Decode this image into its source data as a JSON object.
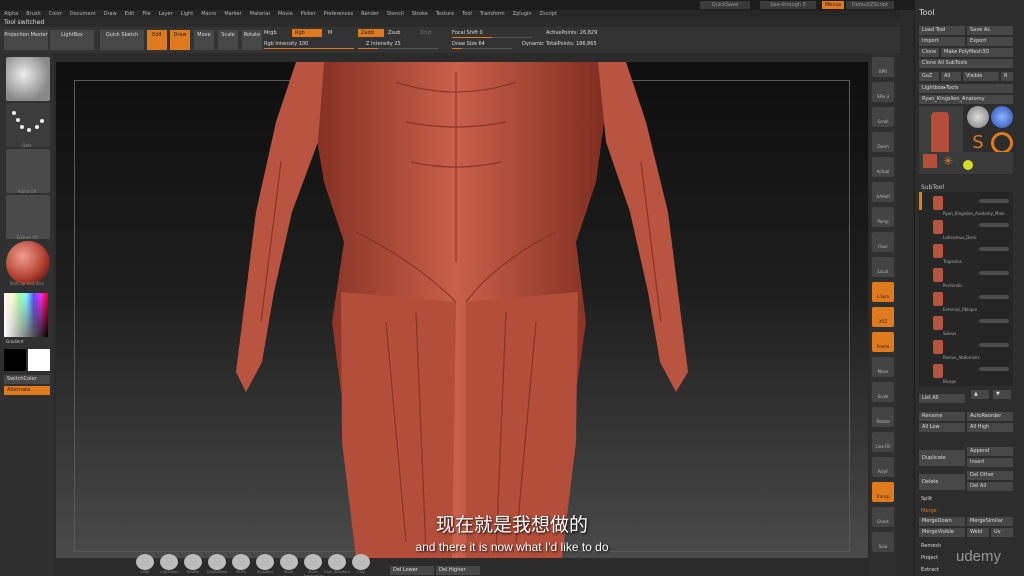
{
  "titlebar": {
    "quicksave": "QuickSave",
    "menus": "See-through 0",
    "default": "Menus",
    "script": "DefaultZScript"
  },
  "menu": [
    "Alpha",
    "Brush",
    "Color",
    "Document",
    "Draw",
    "Edit",
    "File",
    "Layer",
    "Light",
    "Macro",
    "Marker",
    "Material",
    "Movie",
    "Picker",
    "Preferences",
    "Render",
    "Stencil",
    "Stroke",
    "Texture",
    "Tool",
    "Transform",
    "Zplugin",
    "Zscript"
  ],
  "tool_status": "Tool switched",
  "shelf": {
    "projection_master": "Projection Master",
    "lightbox": "LightBox",
    "quick_sketch": "Quick Sketch",
    "edit": "Edit",
    "draw": "Draw",
    "move": "Move",
    "scale": "Scale",
    "rotate": "Rotate",
    "mrgb": "Mrgb",
    "rgb": "Rgb",
    "m": "M",
    "rgb_intensity": "Rgb Intensity 100",
    "zadd": "Zadd",
    "zsub": "Zsub",
    "zcut": "Zcut",
    "z_intensity": "Z Intensity 25",
    "focal_shift": "Focal Shift 0",
    "draw_size": "Draw Size 64",
    "dynamic": "Dynamic",
    "active_points": "ActivePoints: 26,829",
    "total_points": "TotalPoints: 186,865"
  },
  "left": {
    "brush": "Standard",
    "stroke": "Dots",
    "alpha": "Alpha Off",
    "texture": "Texture Off",
    "material": "MatCap Red Wax",
    "gradient": "Gradient",
    "switch_color": "SwitchColor",
    "alternate": "Alternate"
  },
  "rightshelf": [
    "BPR",
    "SPix 3",
    "Scroll",
    "Zoom",
    "Actual",
    "AAHalf",
    "Persp",
    "Floor",
    "Local",
    "L.Sym",
    "XYZ",
    "Frame",
    "Move",
    "Scale",
    "Rotate",
    "Line Fill",
    "PolyF",
    "Transp",
    "Ghost",
    "Solo"
  ],
  "toolpanel": {
    "header": "Tool",
    "load_tool": "Load Tool",
    "save_as": "Save As",
    "import": "Import",
    "export": "Export",
    "clone": "Clone",
    "make_polymesh": "Make PolyMesh3D",
    "clone_all": "Clone All SubTools",
    "goz": "GoZ",
    "all": "All",
    "visible": "Visible",
    "r": "R",
    "lightbox_tools": "Lightbox▸Tools",
    "current_tool": "Ryan_Kingslien_Anatomy",
    "subtool_header": "SubTool",
    "subtools": [
      "Ryan_Kingslien_Anatomy_Male",
      "Latissimus_Dorsi",
      "Trapezius",
      "Pectoralis",
      "External_Oblique",
      "Soleus",
      "Rectus_Abdominis",
      "Biceps"
    ],
    "list_all": "List All",
    "rename": "Rename",
    "auto_reorder": "AutoReorder",
    "all_low": "All Low",
    "all_high": "All High",
    "duplicate": "Duplicate",
    "append": "Append",
    "insert": "Insert",
    "delete": "Delete",
    "del_other": "Del Other",
    "del_all": "Del All",
    "split": "Split",
    "merge": "Merge",
    "merge_down": "MergeDown",
    "merge_similar": "MergeSimilar",
    "merge_visible": "MergeVisible",
    "weld": "Weld",
    "uv": "Uv",
    "remesh": "Remesh",
    "project": "Project",
    "extract": "Extract"
  },
  "bottombar": [
    "Inflat",
    "ClayTubes",
    "hPolish",
    "ClayBuildup",
    "Pinch",
    "Standard",
    "Move",
    "Move Topological",
    "Dam_Standard",
    "Clay"
  ],
  "bottom_tabs": {
    "del_lower": "Del Lower",
    "del_higher": "Del Higher"
  },
  "subtitle_cn": "现在就是我想做的",
  "subtitle_en": "and there it is now what I'd like to do",
  "watermark": "udemy"
}
